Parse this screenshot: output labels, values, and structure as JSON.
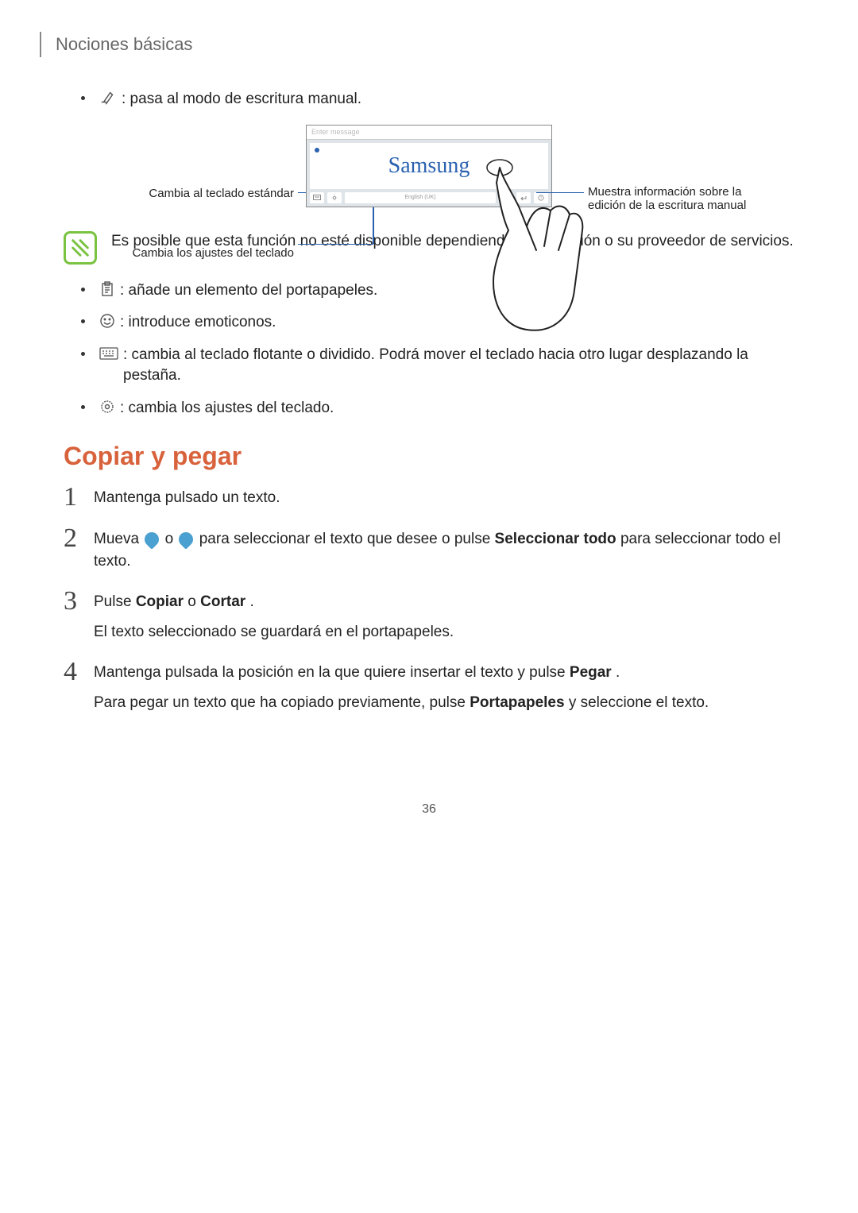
{
  "chapter": "Nociones básicas",
  "bullet_handwriting": " : pasa al modo de escritura manual.",
  "diagram": {
    "left1": "Cambia al teclado estándar",
    "left2": "Cambia los ajustes del teclado",
    "right1": "Muestra información sobre la edición de la escritura manual",
    "placeholder": "Enter message",
    "written": "Samsung",
    "lang": "English (UK)"
  },
  "note": "Es posible que esta función no esté disponible dependiendo de su región o su proveedor de servicios.",
  "bullets": {
    "clipboard": " : añade un elemento del portapapeles.",
    "emoji": " : introduce emoticonos.",
    "kbmode": " : cambia al teclado flotante o dividido. Podrá mover el teclado hacia otro lugar desplazando la pestaña.",
    "settings": " : cambia los ajustes del teclado."
  },
  "section_title": "Copiar y pegar",
  "steps": {
    "s1": "Mantenga pulsado un texto.",
    "s2a": "Mueva ",
    "s2b": " o ",
    "s2c": " para seleccionar el texto que desee o pulse ",
    "s2d": "Seleccionar todo",
    "s2e": " para seleccionar todo el texto.",
    "s3a": "Pulse ",
    "s3b": "Copiar",
    "s3c": " o ",
    "s3d": "Cortar",
    "s3e": ".",
    "s3_sub": "El texto seleccionado se guardará en el portapapeles.",
    "s4a": "Mantenga pulsada la posición en la que quiere insertar el texto y pulse ",
    "s4b": "Pegar",
    "s4c": ".",
    "s4_sub_a": "Para pegar un texto que ha copiado previamente, pulse ",
    "s4_sub_b": "Portapapeles",
    "s4_sub_c": " y seleccione el texto."
  },
  "pagenum": "36"
}
